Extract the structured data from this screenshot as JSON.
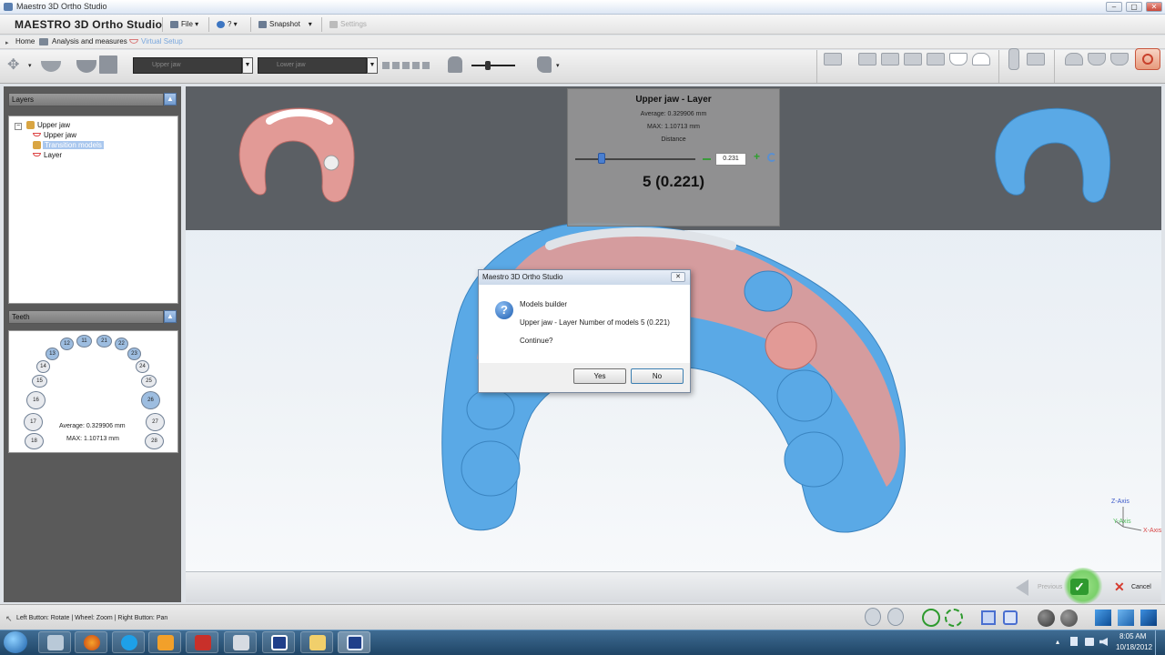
{
  "window": {
    "title": "Maestro 3D Ortho Studio",
    "controls": [
      "–",
      "▢",
      "✕"
    ]
  },
  "menu": {
    "app_title": "MAESTRO 3D Ortho Studio",
    "file": "File",
    "help": "?",
    "snapshot": "Snapshot",
    "settings": "Settings"
  },
  "nav": {
    "home": "Home",
    "analysis": "Analysis and measures",
    "virtual_setup": "Virtual Setup"
  },
  "toolbar": {
    "upper_combo": "Upper jaw",
    "lower_combo": "Lower jaw"
  },
  "layers": {
    "header": "Layers",
    "collapse": "▲",
    "items": [
      {
        "label": "Upper jaw"
      },
      {
        "label": "Upper jaw"
      },
      {
        "label": "Transition models"
      },
      {
        "label": "Layer"
      }
    ]
  },
  "teeth": {
    "header": "Teeth",
    "collapse": "▲",
    "numbers": [
      "12",
      "11",
      "21",
      "22",
      "13",
      "23",
      "14",
      "24",
      "15",
      "25",
      "16",
      "26",
      "17",
      "27",
      "18",
      "28"
    ],
    "highlighted": [
      "12",
      "11",
      "21",
      "22",
      "13",
      "23",
      "26"
    ],
    "average": "Average: 0.329906 mm",
    "max": "MAX: 1.10713 mm"
  },
  "info": {
    "title": "Upper jaw - Layer",
    "average": "Average: 0.329906 mm",
    "max": "MAX: 1.10713 mm",
    "distance": "Distance",
    "value": "0.231",
    "slider_fraction": 0.22,
    "result": "5 (0.221)"
  },
  "dialog": {
    "title": "Maestro 3D Ortho Studio",
    "heading": "Models builder",
    "message": "Upper jaw - Layer Number of models 5 (0.221)",
    "question": "Continue?",
    "yes": "Yes",
    "no": "No",
    "close": "✕"
  },
  "axes": {
    "z": "Z-Axis",
    "y": "Y-Axis",
    "x": "X-Axis"
  },
  "bottom": {
    "previous": "Previous",
    "cancel": "Cancel"
  },
  "status": {
    "hint": "Left Button: Rotate | Wheel: Zoom | Right Button: Pan"
  },
  "taskbar": {
    "time": "8:05 AM",
    "date": "10/18/2012"
  },
  "colors": {
    "upper_model": "#e29a96",
    "lower_model": "#5aa9e6",
    "dark_band": "#5b5f64",
    "selection": "#a9c7ee"
  }
}
